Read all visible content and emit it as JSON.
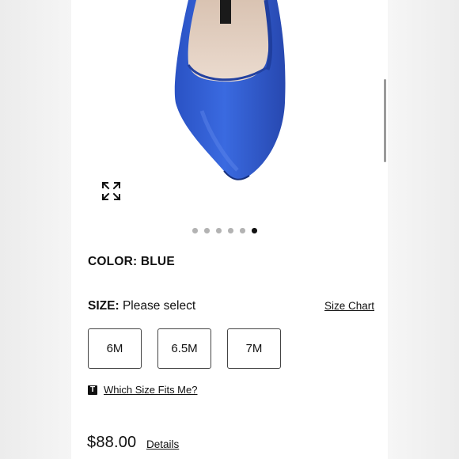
{
  "product": {
    "color_label": "COLOR:",
    "color_value": "BLUE",
    "size_label": "SIZE:",
    "size_value": "Please select",
    "size_chart_link": "Size Chart",
    "sizes": [
      "6M",
      "6.5M",
      "7M"
    ],
    "fit_badge": "T",
    "fit_link": "Which Size Fits Me?",
    "price": "$88.00",
    "details_link": "Details",
    "shoe_color": "#2f5fd0"
  },
  "gallery": {
    "total_images": 6,
    "active_index": 5,
    "expand_icon": "expand-arrows-icon"
  }
}
